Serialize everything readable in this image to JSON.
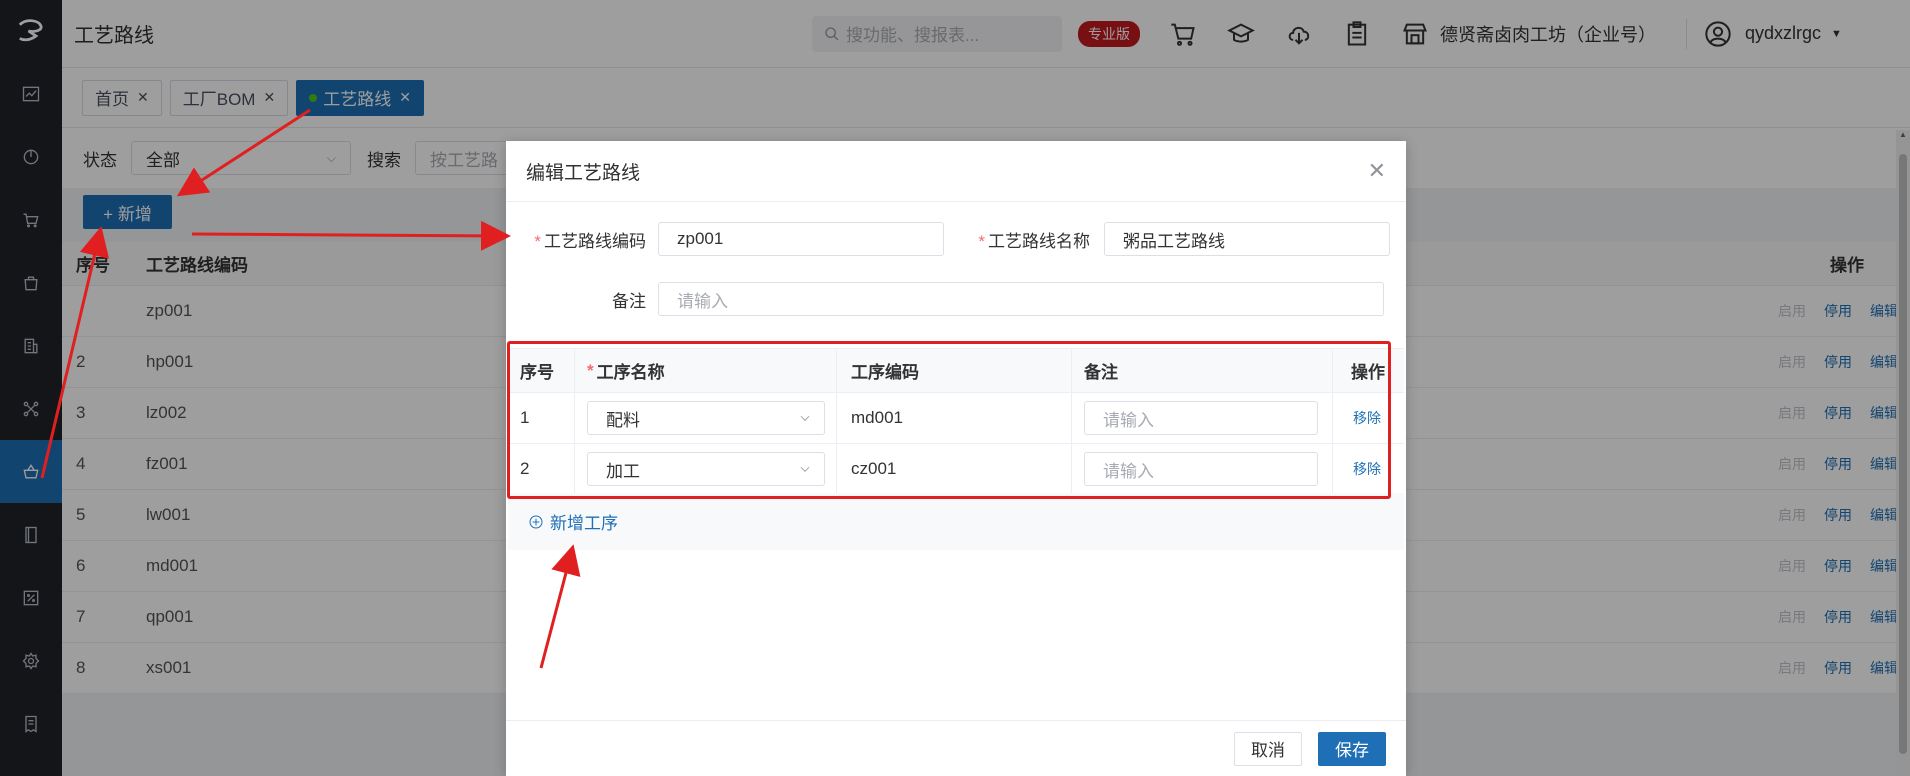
{
  "header": {
    "title": "工艺路线",
    "search_placeholder": "搜功能、搜报表...",
    "pro_badge": "专业版",
    "company": "德贤斋卤肉工坊（企业号）",
    "username": "qydxzlrgc"
  },
  "tabs": [
    {
      "label": "首页",
      "active": false
    },
    {
      "label": "工厂BOM",
      "active": false
    },
    {
      "label": "工艺路线",
      "active": true
    }
  ],
  "filter": {
    "status_label": "状态",
    "status_value": "全部",
    "search_label": "搜索",
    "search_placeholder": "按工艺路"
  },
  "toolbar": {
    "add_label": "+ 新增"
  },
  "table": {
    "headers": {
      "index": "序号",
      "code": "工艺路线编码",
      "ops": "操作"
    },
    "op_labels": {
      "enable": "启用",
      "disable": "停用",
      "edit": "编辑"
    },
    "rows": [
      {
        "index": "",
        "code": "zp001"
      },
      {
        "index": "2",
        "code": "hp001"
      },
      {
        "index": "3",
        "code": "lz002"
      },
      {
        "index": "4",
        "code": "fz001"
      },
      {
        "index": "5",
        "code": "lw001"
      },
      {
        "index": "6",
        "code": "md001"
      },
      {
        "index": "7",
        "code": "qp001"
      },
      {
        "index": "8",
        "code": "xs001"
      }
    ]
  },
  "modal": {
    "title": "编辑工艺路线",
    "code_label": "工艺路线编码",
    "code_value": "zp001",
    "name_label": "工艺路线名称",
    "name_value": "粥品工艺路线",
    "remark_label": "备注",
    "remark_placeholder": "请输入",
    "process_table": {
      "headers": {
        "index": "序号",
        "name": "工序名称",
        "code": "工序编码",
        "note": "备注",
        "ops": "操作"
      },
      "rows": [
        {
          "index": "1",
          "name": "配料",
          "code": "md001",
          "note_placeholder": "请输入",
          "remove": "移除"
        },
        {
          "index": "2",
          "name": "加工",
          "code": "cz001",
          "note_placeholder": "请输入",
          "remove": "移除"
        }
      ]
    },
    "add_process_label": "新增工序",
    "cancel_label": "取消",
    "save_label": "保存"
  },
  "colors": {
    "primary": "#1e6fb5",
    "sidebar": "#1f2329",
    "badge": "#c0191f",
    "annotation": "#e02020"
  }
}
